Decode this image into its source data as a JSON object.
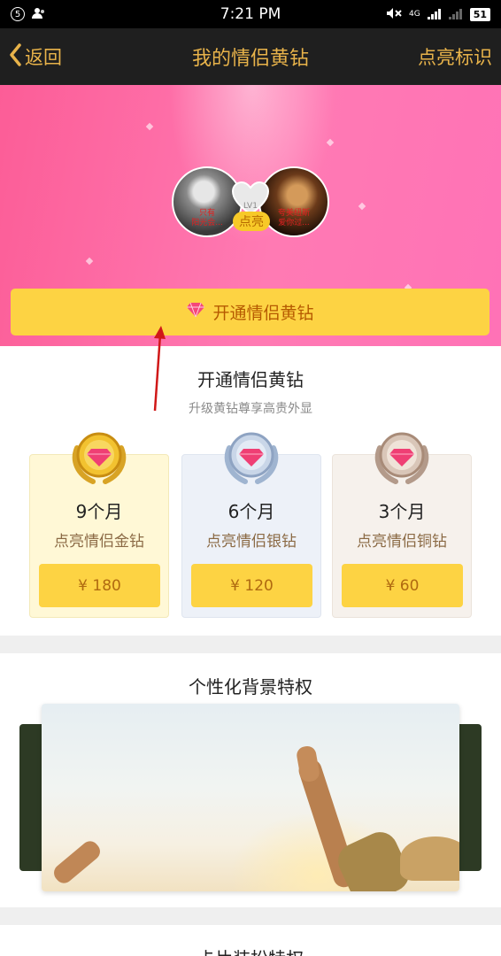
{
  "status_bar": {
    "notif_count": "5",
    "time": "7:21 PM",
    "network": "4G",
    "battery": "51"
  },
  "nav": {
    "back_label": "返回",
    "title": "我的情侣黄钻",
    "right_label": "点亮标识"
  },
  "hero": {
    "avatar_left_caption": "只有\n阳光会...",
    "avatar_right_caption": "夸美纽斯\n爱你过...",
    "level": "LV1",
    "light_label": "点亮",
    "open_button": "开通情侣黄钻"
  },
  "purchase": {
    "title": "开通情侣黄钻",
    "subtitle": "升级黄钻尊享高贵外显",
    "cards": [
      {
        "duration": "9个月",
        "tier": "点亮情侣金钻",
        "price": "¥ 180",
        "medal": "gold-diamond-medal-icon"
      },
      {
        "duration": "6个月",
        "tier": "点亮情侣银钻",
        "price": "¥ 120",
        "medal": "silver-diamond-medal-icon"
      },
      {
        "duration": "3个月",
        "tier": "点亮情侣铜钻",
        "price": "¥ 60",
        "medal": "bronze-diamond-medal-icon"
      }
    ]
  },
  "background_privilege": {
    "title": "个性化背景特权"
  },
  "card_privilege": {
    "title": "卡片装扮特权"
  },
  "colors": {
    "nav_bg": "#1f1f1f",
    "nav_text": "#e8b34a",
    "hero_pink": "#ff7ab3",
    "button_yellow": "#fdd343",
    "button_text": "#b65a00"
  }
}
